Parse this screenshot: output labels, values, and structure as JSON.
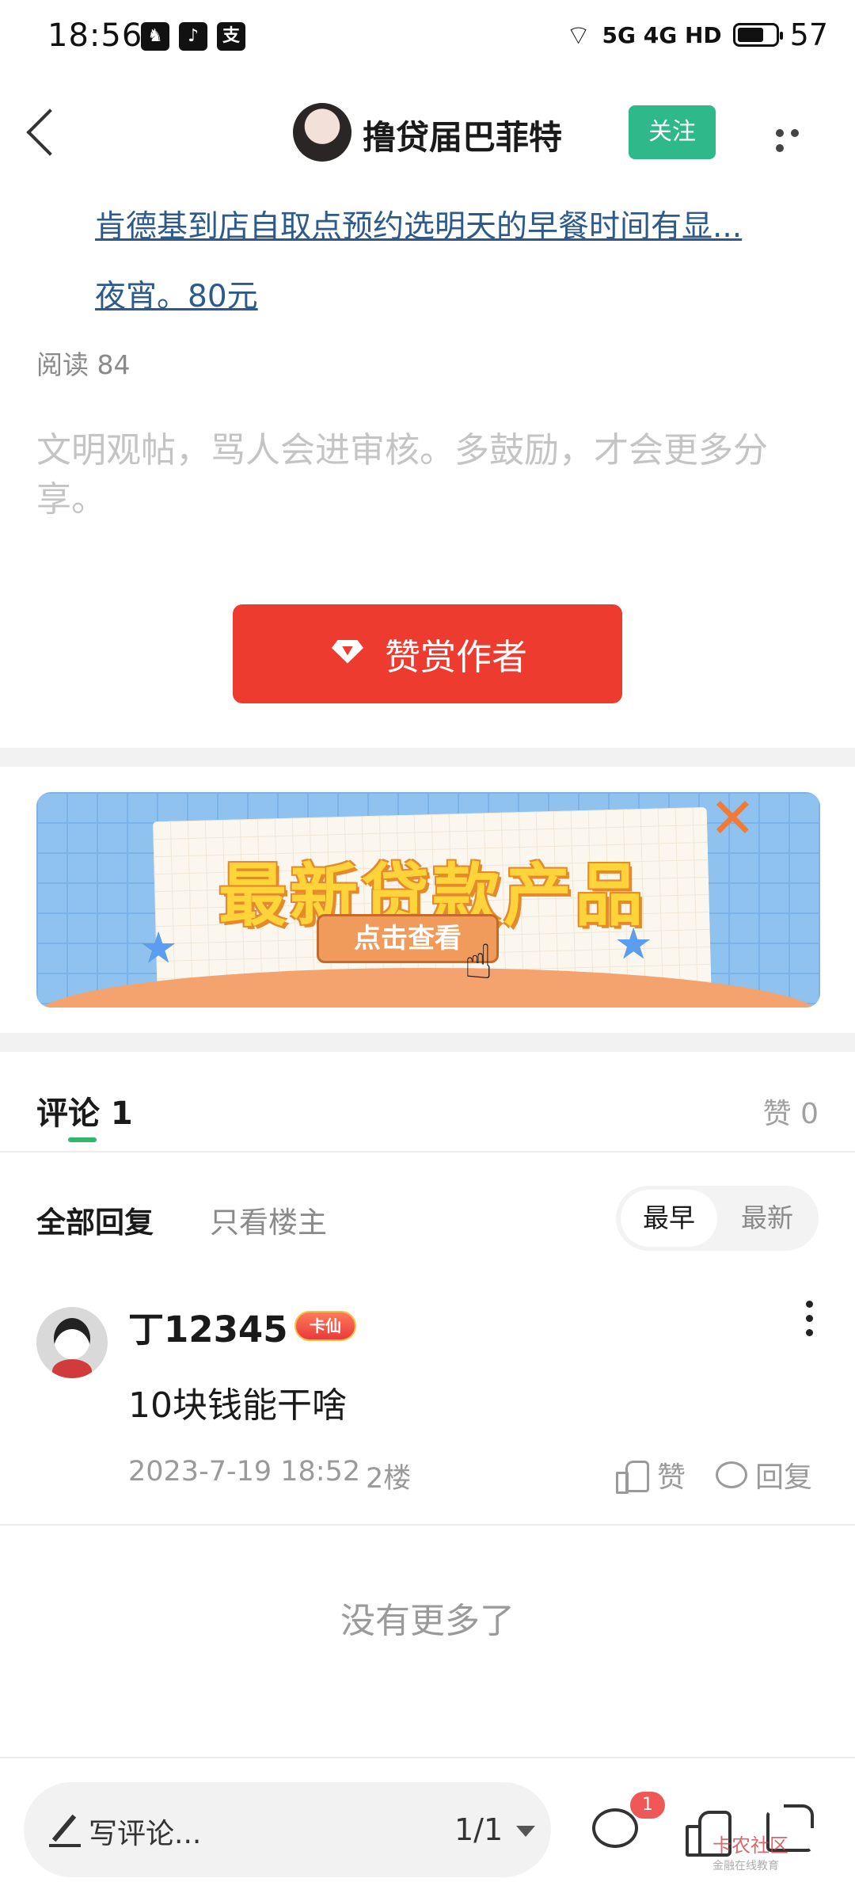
{
  "status_bar": {
    "time": "18:56",
    "network": "5G 4G HD",
    "battery": "57"
  },
  "header": {
    "author": "撸贷届巴菲特",
    "follow_label": "关注"
  },
  "article": {
    "link_line1": "肯德基到店自取点预约选明天的早餐时间有显...",
    "link_line2": "夜宵。80元",
    "reads_label": "阅读 84",
    "notice": "文明观帖，骂人会进审核。多鼓励，才会更多分享。",
    "reward_label": "赞赏作者"
  },
  "banner": {
    "title": "最新贷款产品",
    "button": "点击查看"
  },
  "comments": {
    "tab_label": "评论 1",
    "likes_label": "赞 0",
    "filter_all": "全部回复",
    "filter_op": "只看楼主",
    "sort_early": "最早",
    "sort_new": "最新",
    "items": [
      {
        "name": "丁12345",
        "badge": "卡仙",
        "text": "10块钱能干啥",
        "time": "2023-7-19 18:52",
        "floor": "2楼",
        "like_label": "赞",
        "reply_label": "回复"
      }
    ],
    "no_more": "没有更多了"
  },
  "bottom_bar": {
    "write_placeholder": "写评论...",
    "pager": "1/1",
    "comment_count": "1",
    "watermark": "卡农社区",
    "watermark_sub": "金融在线教育"
  }
}
